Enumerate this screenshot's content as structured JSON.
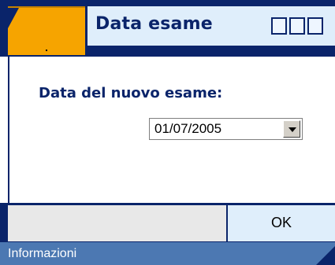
{
  "window": {
    "title": "Data esame"
  },
  "dialog": {
    "prompt": "Data del nuovo esame:",
    "date_select": {
      "value": "01/07/2005"
    },
    "ok_label": "OK"
  },
  "statusbar": {
    "text": "Informazioni"
  },
  "colors": {
    "frame": "#0a246a",
    "accent_tab": "#f6a400",
    "title_bg": "#dfeefb",
    "status_bg": "#4c78b2"
  }
}
